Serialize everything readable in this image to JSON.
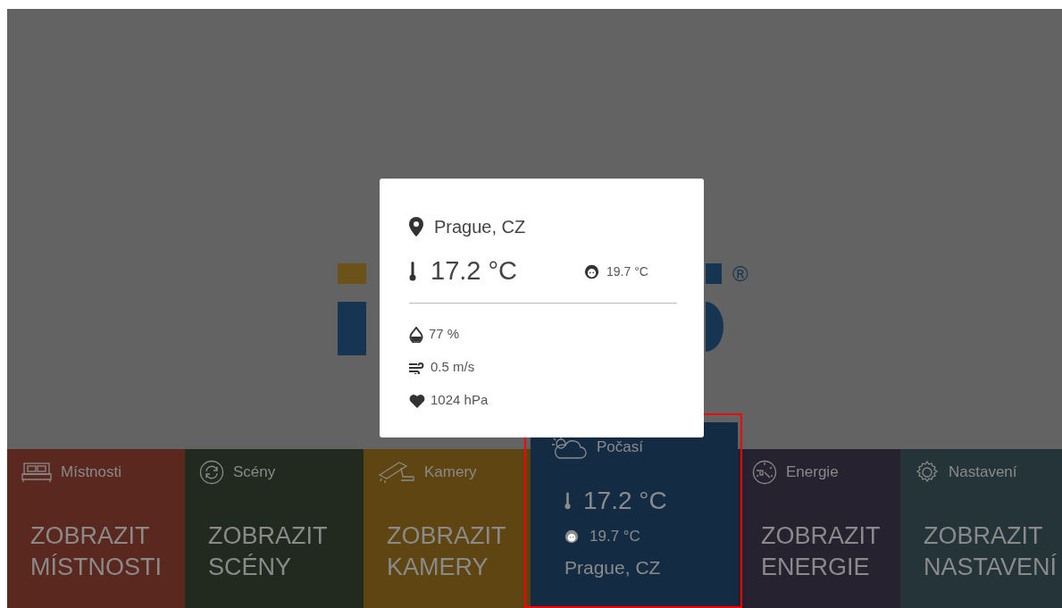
{
  "logo": {
    "mark": "®"
  },
  "popup": {
    "location": "Prague, CZ",
    "temperature": "17.2 °C",
    "feels_like": "19.7 °C",
    "details": [
      {
        "kind": "humidity",
        "value": "77 %"
      },
      {
        "kind": "wind",
        "value": "0.5 m/s"
      },
      {
        "kind": "pressure",
        "value": "1024 hPa"
      }
    ]
  },
  "tiles": [
    {
      "kind": "rooms",
      "label": "Místnosti",
      "action": "ZOBRAZIT MÍSTNOSTI",
      "color": "#5a281e",
      "selected": false
    },
    {
      "kind": "scenes",
      "label": "Scény",
      "action": "ZOBRAZIT SCÉNY",
      "color": "#222a20",
      "selected": false
    },
    {
      "kind": "cameras",
      "label": "Kamery",
      "action": "ZOBRAZIT KAMERY",
      "color": "#5e4512",
      "selected": false
    },
    {
      "kind": "weather",
      "label": "Počasí",
      "temperature": "17.2 °C",
      "feels_like": "19.7 °C",
      "location": "Prague, CZ",
      "color": "#132c44",
      "selected": true
    },
    {
      "kind": "energy",
      "label": "Energie",
      "action": "ZOBRAZIT ENERGIE",
      "color": "#262230",
      "selected": false
    },
    {
      "kind": "settings",
      "label": "Nastavení",
      "action": "ZOBRAZIT NASTAVENÍ",
      "color": "#243438",
      "selected": false
    }
  ]
}
